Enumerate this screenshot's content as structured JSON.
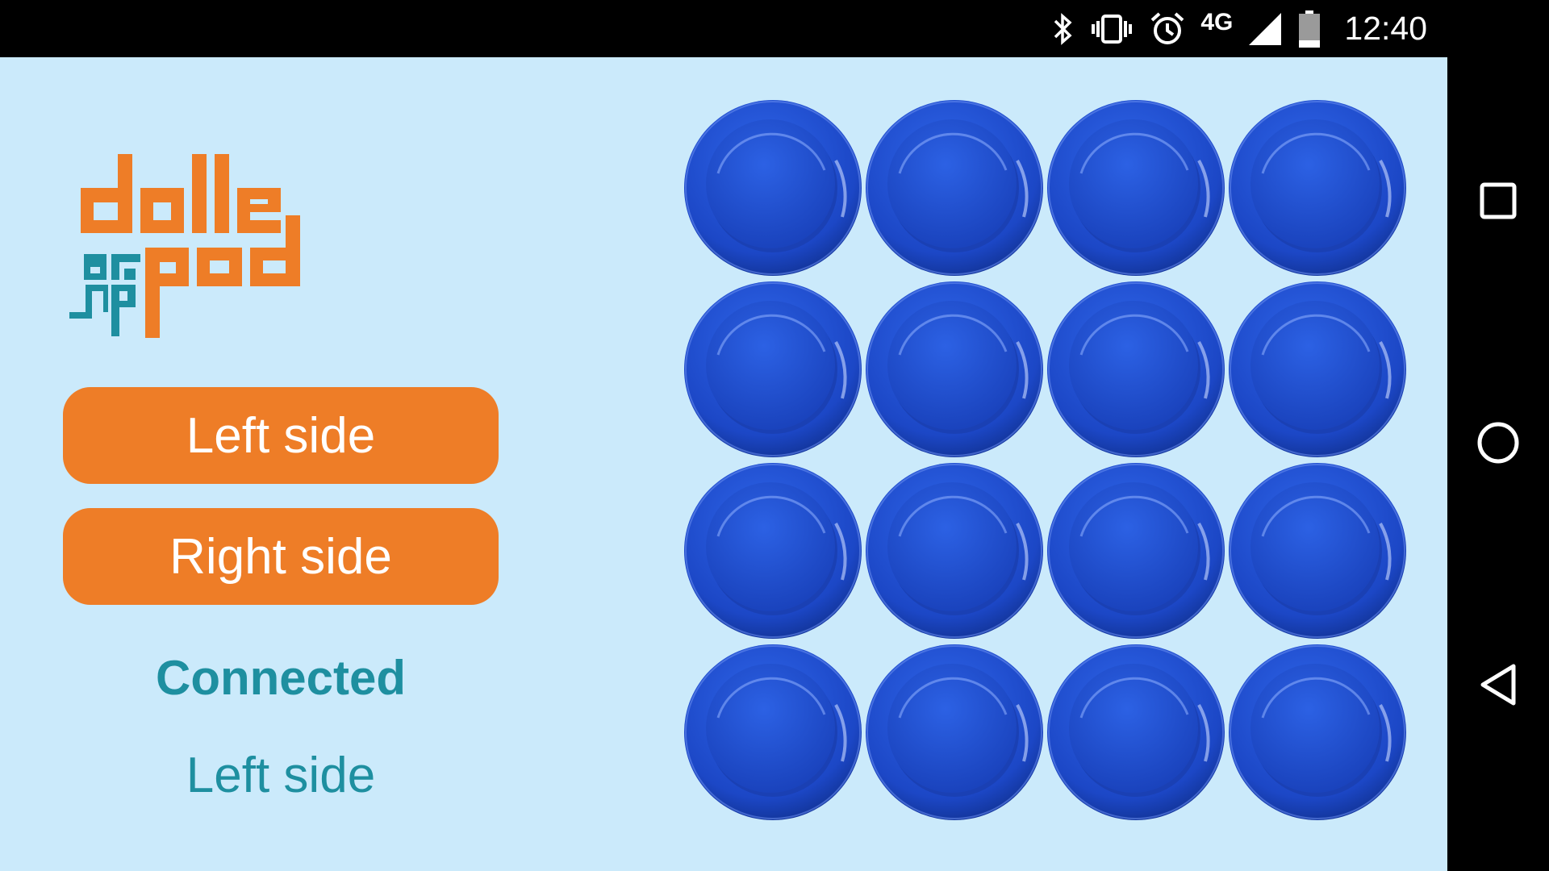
{
  "status_bar": {
    "network": "4G",
    "time": "12:40",
    "icons": [
      "bluetooth-icon",
      "vibrate-icon",
      "alarm-icon",
      "signal-icon",
      "battery-icon"
    ]
  },
  "app": {
    "logo": {
      "line1": "dalle",
      "line2": "pad",
      "mark": "dp"
    },
    "left_button_label": "Left side",
    "right_button_label": "Right side",
    "connection_status": "Connected",
    "current_side": "Left side",
    "colors": {
      "background": "#cbeafb",
      "accent_orange": "#ee7d27",
      "teal": "#1e8fa0",
      "pad_blue": "#1f4fd0"
    },
    "pad_grid": {
      "rows": 4,
      "columns": 4
    }
  },
  "navigation_bar": {
    "buttons": [
      "recents-icon",
      "home-icon",
      "back-icon"
    ]
  }
}
